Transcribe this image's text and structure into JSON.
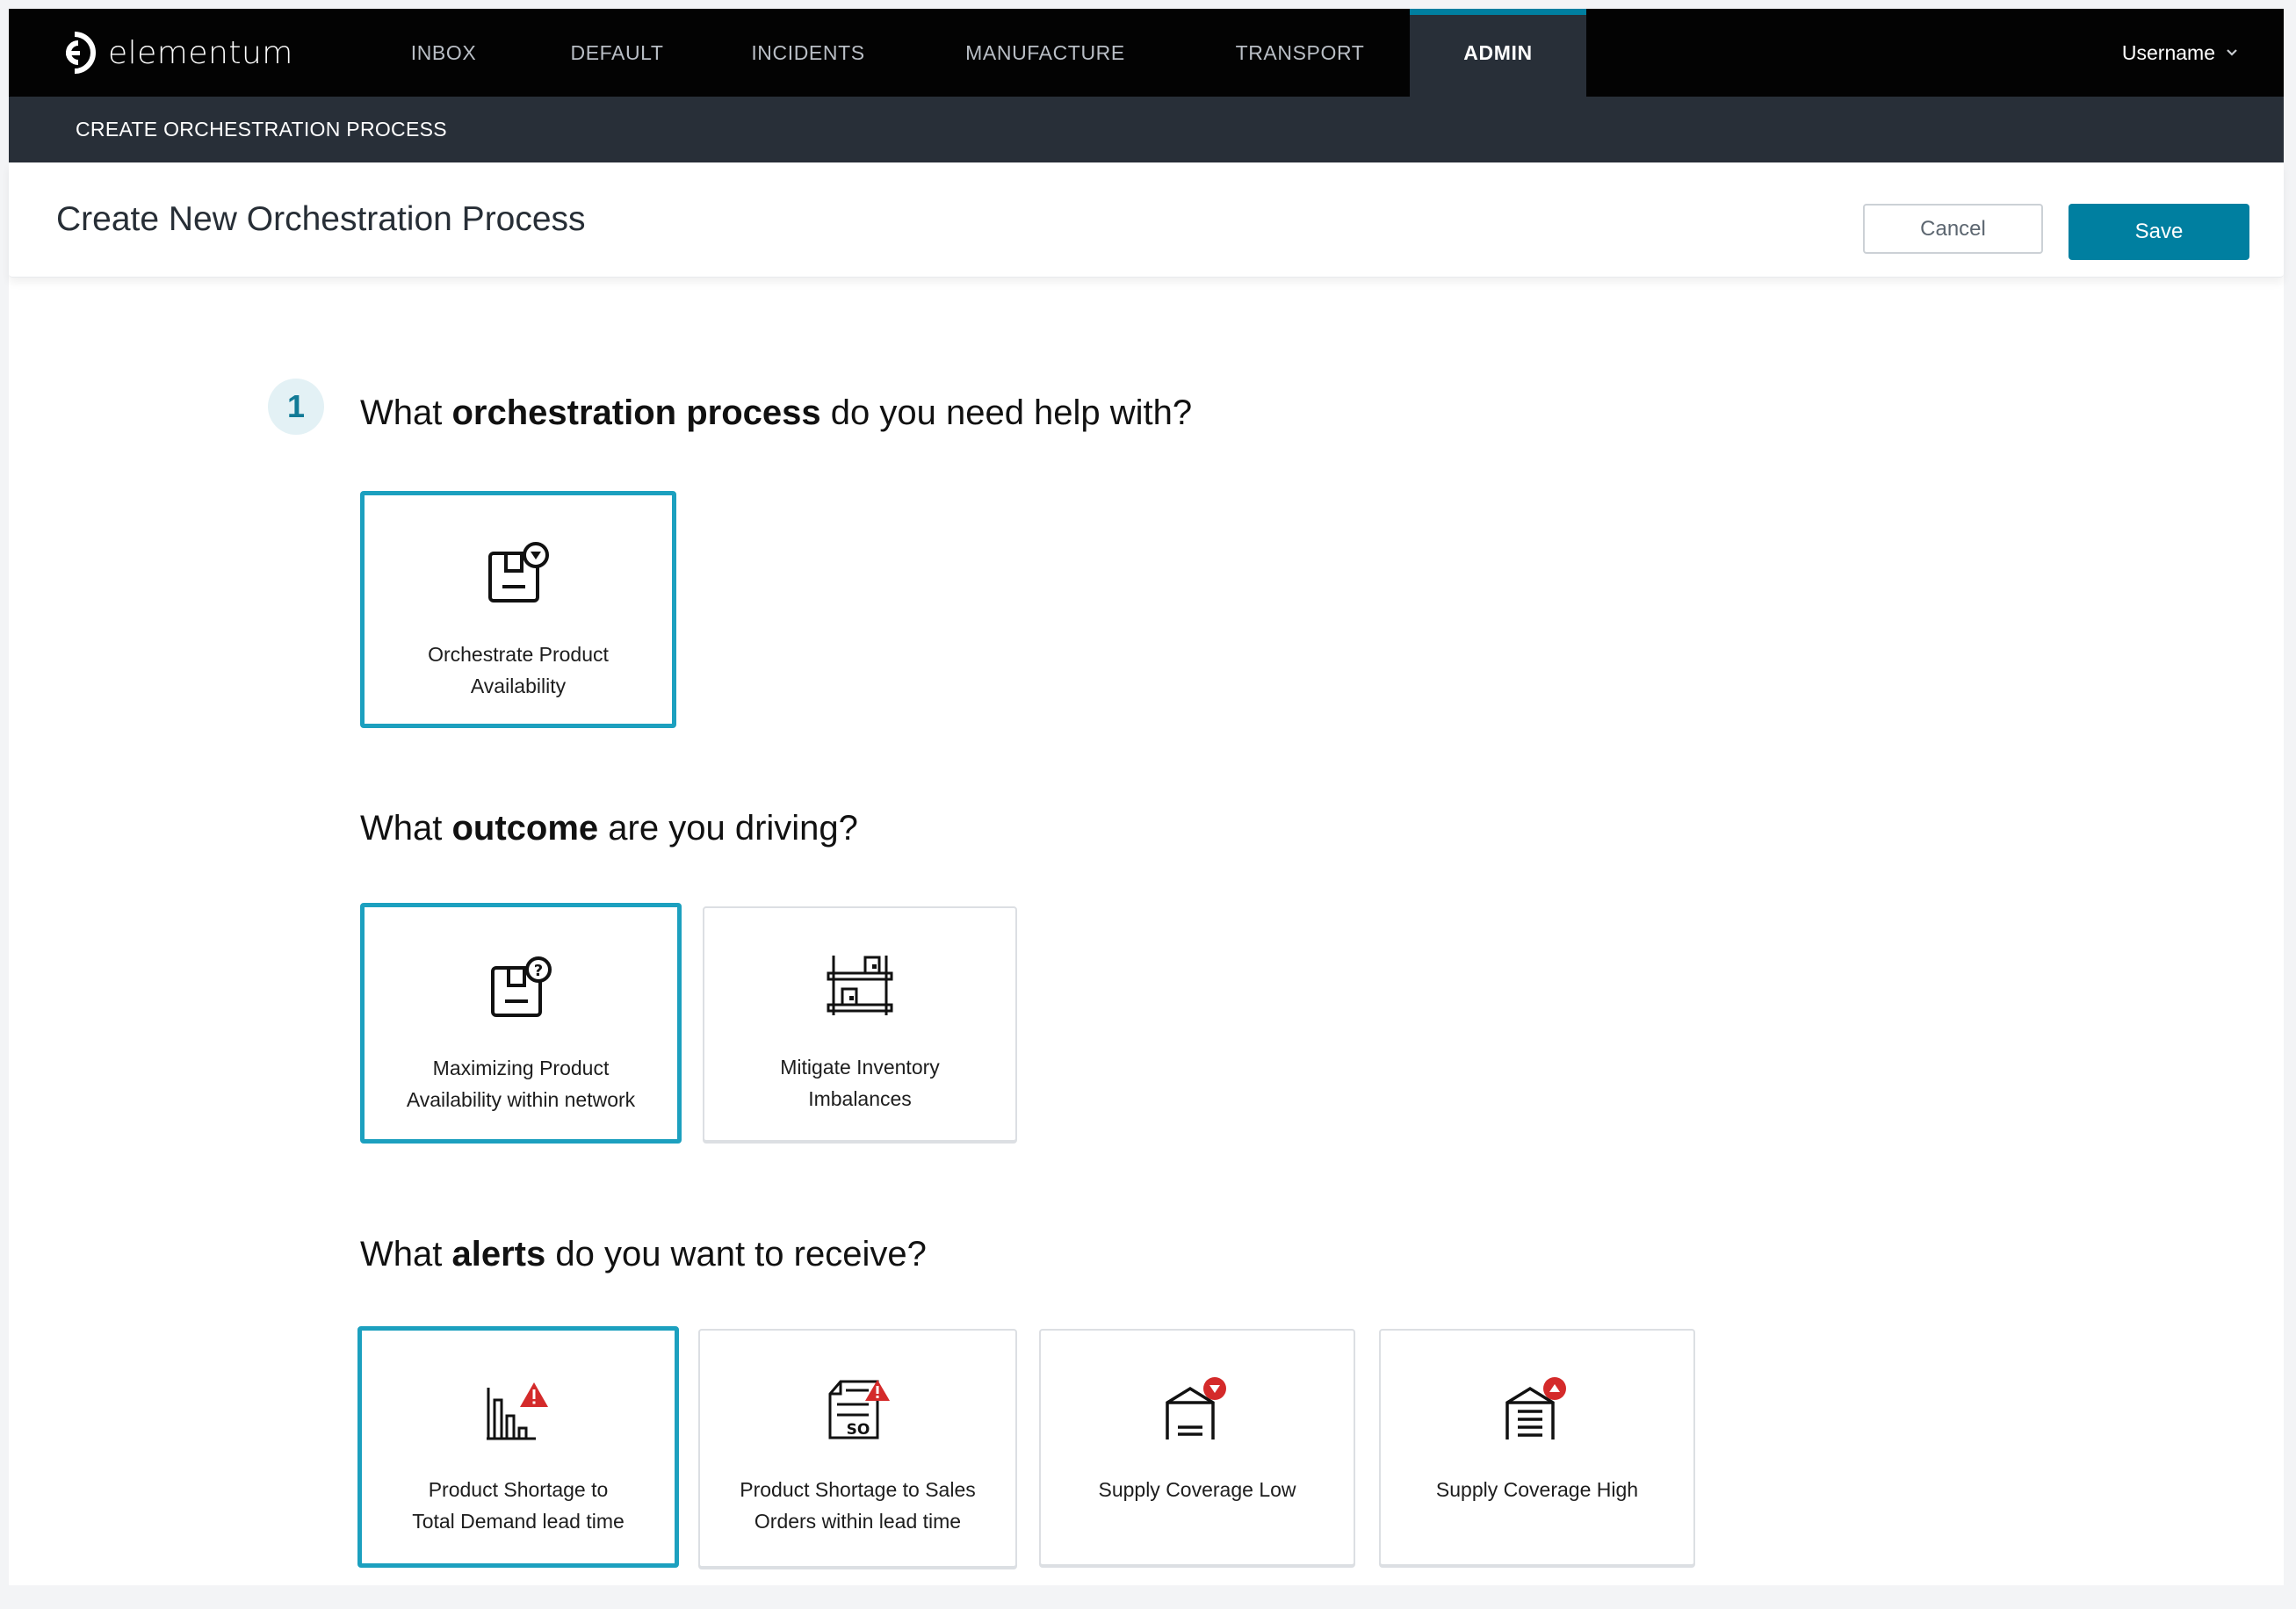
{
  "app": {
    "brand": "elementum",
    "nav": [
      {
        "label": "INBOX",
        "active": false
      },
      {
        "label": "DEFAULT",
        "active": false
      },
      {
        "label": "INCIDENTS",
        "active": false
      },
      {
        "label": "MANUFACTURE",
        "active": false
      },
      {
        "label": "TRANSPORT",
        "active": false
      },
      {
        "label": "ADMIN",
        "active": true
      }
    ],
    "user_menu": {
      "label": "Username",
      "icon": "chevron-down-icon"
    },
    "colors": {
      "accent": "#007fa0",
      "selected_border": "#1ca0bf",
      "alert_red": "#d42a2a",
      "nav_bg": "#030303",
      "subnav_bg": "#282f38"
    }
  },
  "subheader": {
    "title": "CREATE ORCHESTRATION PROCESS"
  },
  "page_header": {
    "title": "Create New Orchestration Process",
    "cancel_label": "Cancel",
    "save_label": "Save"
  },
  "step": {
    "number": "1"
  },
  "questions": {
    "process": {
      "prefix": "What ",
      "bold": "orchestration process",
      "suffix": " do you need help with?",
      "options": [
        {
          "label_line1": "Orchestrate Product",
          "label_line2": "Availability",
          "icon": "box-dropdown-icon",
          "selected": true
        }
      ]
    },
    "outcome": {
      "prefix": "What ",
      "bold": "outcome",
      "suffix": " are you driving?",
      "options": [
        {
          "label_line1": "Maximizing Product",
          "label_line2": "Availability within network",
          "icon": "box-question-icon",
          "selected": true
        },
        {
          "label_line1": "Mitigate Inventory",
          "label_line2": "Imbalances",
          "icon": "shelves-icon",
          "selected": false
        }
      ]
    },
    "alerts": {
      "prefix": "What ",
      "bold": "alerts",
      "suffix": " do you want to receive?",
      "options": [
        {
          "label_line1": "Product Shortage to",
          "label_line2": "Total Demand lead time",
          "icon": "bar-chart-warning-icon",
          "selected": true
        },
        {
          "label_line1": "Product Shortage to Sales",
          "label_line2": "Orders within lead time",
          "icon": "sales-order-warning-icon",
          "selected": false
        },
        {
          "label_line1": "Supply Coverage Low",
          "label_line2": "",
          "icon": "warehouse-low-icon",
          "selected": false
        },
        {
          "label_line1": "Supply Coverage High",
          "label_line2": "",
          "icon": "warehouse-high-icon",
          "selected": false
        }
      ]
    }
  }
}
